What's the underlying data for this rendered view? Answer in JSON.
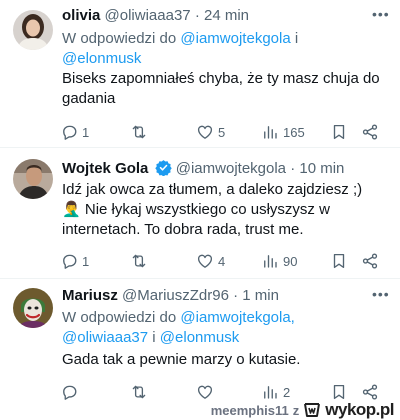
{
  "tweets": [
    {
      "name": "olivia",
      "handle": "@oliwiaaa37",
      "dot": "·",
      "time": "24 min",
      "verified": false,
      "reply_prefix": "W odpowiedzi do ",
      "reply_user1": "@iamwojtekgola",
      "reply_sep": " i",
      "reply_user2": "@elonmusk",
      "text": "Biseks zapomniałeś chyba, że ty masz chuja do gadania",
      "stats": {
        "replies": "1",
        "retweets": "",
        "likes": "5",
        "views": "165"
      }
    },
    {
      "name": "Wojtek Gola",
      "handle": "@iamwojtekgola",
      "dot": "·",
      "time": "10 min",
      "verified": true,
      "text_line1": "Idź jak owca za tłumem, a daleko zajdziesz ;)",
      "text_line2_emoji": "🤦‍♂️",
      "text_line2": " Nie łykaj wszystkiego co usłyszysz w",
      "text_line3": "internetach. To dobra rada, trust me.",
      "stats": {
        "replies": "1",
        "retweets": "",
        "likes": "4",
        "views": "90"
      }
    },
    {
      "name": "Mariusz",
      "handle": "@MariuszZdr96",
      "dot": "·",
      "time": "1 min",
      "verified": false,
      "reply_prefix": "W odpowiedzi do ",
      "reply_user1": "@iamwojtekgola,",
      "reply_user2": "@oliwiaaa37",
      "reply_sep": " i ",
      "reply_user3": "@elonmusk",
      "text": "Gada tak a pewnie marzy o kutasie.",
      "stats": {
        "replies": "",
        "retweets": "",
        "likes": "",
        "views": "2"
      }
    }
  ],
  "watermark": {
    "user": "meemphis11",
    "sep": "z",
    "site": "wykop.pl"
  },
  "colors": {
    "link": "#1d9bf0",
    "muted": "#536471",
    "text": "#0f1419",
    "verified": "#1d9bf0"
  },
  "icons": [
    "reply-icon",
    "retweet-icon",
    "like-icon",
    "views-icon",
    "bookmark-icon",
    "share-icon",
    "more-icon",
    "verified-badge-icon"
  ]
}
